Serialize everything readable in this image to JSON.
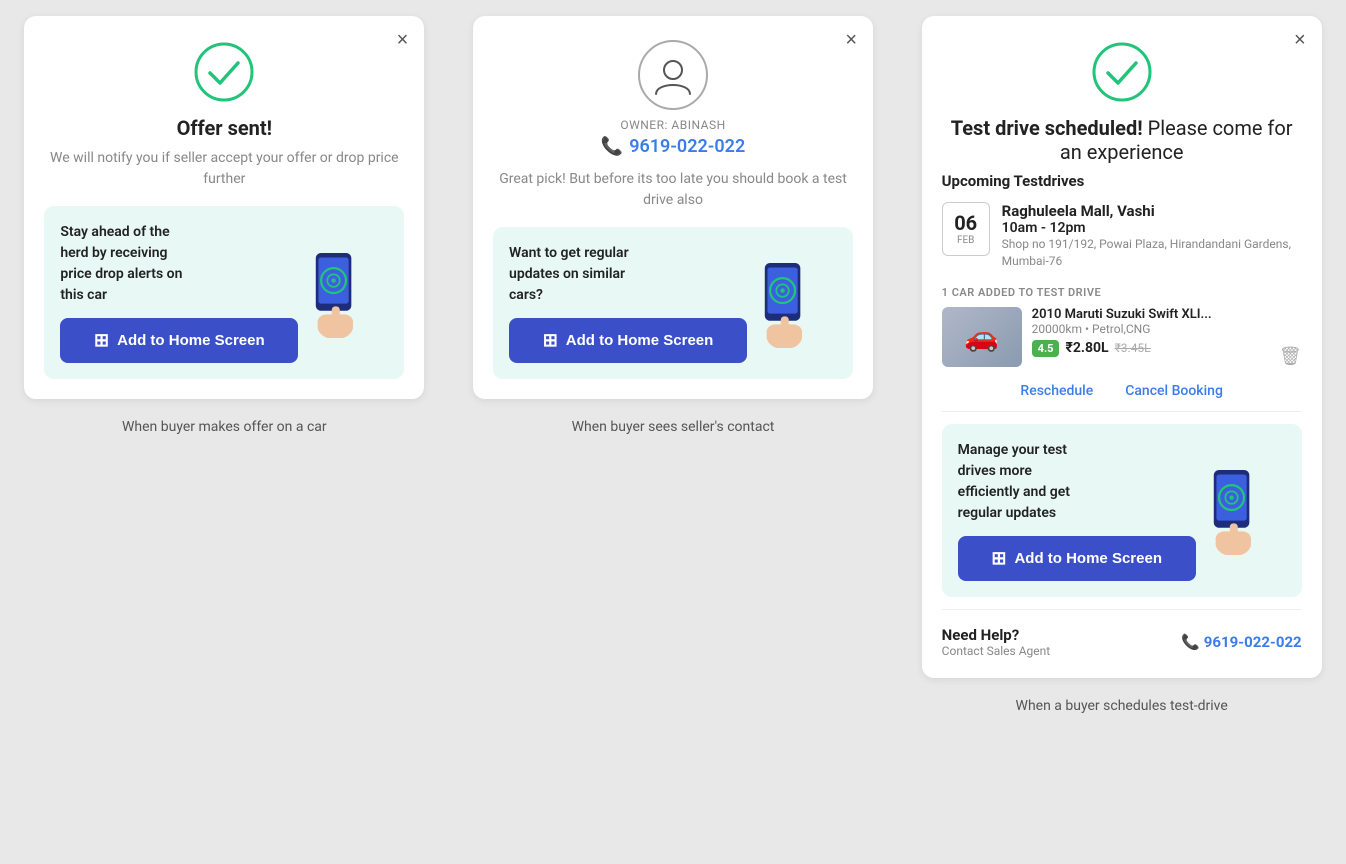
{
  "panel1": {
    "close_label": "×",
    "title": "Offer sent!",
    "subtitle": "We will notify you if seller accept your offer or drop price further",
    "promo_text": "Stay ahead of the herd by receiving price drop alerts on this car",
    "add_btn_label": "Add to Home Screen",
    "bottom_label": "When buyer makes offer on a car"
  },
  "panel2": {
    "close_label": "×",
    "owner_prefix": "OWNER: ABINASH",
    "phone": "9619-022-022",
    "subtitle": "Great pick! But before its too late you should book a test drive also",
    "promo_text": "Want to get regular updates on similar cars?",
    "add_btn_label": "Add to Home Screen",
    "bottom_label": "When buyer sees seller's contact"
  },
  "panel3": {
    "close_label": "×",
    "title_bold": "Test drive scheduled!",
    "title_normal": " Please come for an experience",
    "upcoming_label": "Upcoming Testdrives",
    "date_num": "06",
    "date_month": "FEB",
    "venue_name": "Raghuleela Mall, Vashi",
    "venue_time": "10am - 12pm",
    "venue_address": "Shop no 191/192, Powai Plaza, Hirandandani Gardens, Mumbai-76",
    "car_added_label": "1 CAR ADDED TO TEST DRIVE",
    "car_name": "2010 Maruti Suzuki Swift XLI...",
    "car_meta": "20000km • Petrol,CNG",
    "car_rating": "4.5",
    "car_price": "₹2.80L",
    "car_price_old": "₹3.45L",
    "reschedule_label": "Reschedule",
    "cancel_label": "Cancel Booking",
    "promo_text": "Manage your test drives more efficiently and get regular updates",
    "add_btn_label": "Add to Home Screen",
    "help_title": "Need Help?",
    "help_sub": "Contact Sales Agent",
    "help_phone": "9619-022-022",
    "bottom_label": "When a buyer schedules test-drive"
  },
  "colors": {
    "accent": "#3b4fc8",
    "green": "#22c47a",
    "blue_link": "#3b7de8",
    "promo_bg": "#e8f8f4"
  }
}
